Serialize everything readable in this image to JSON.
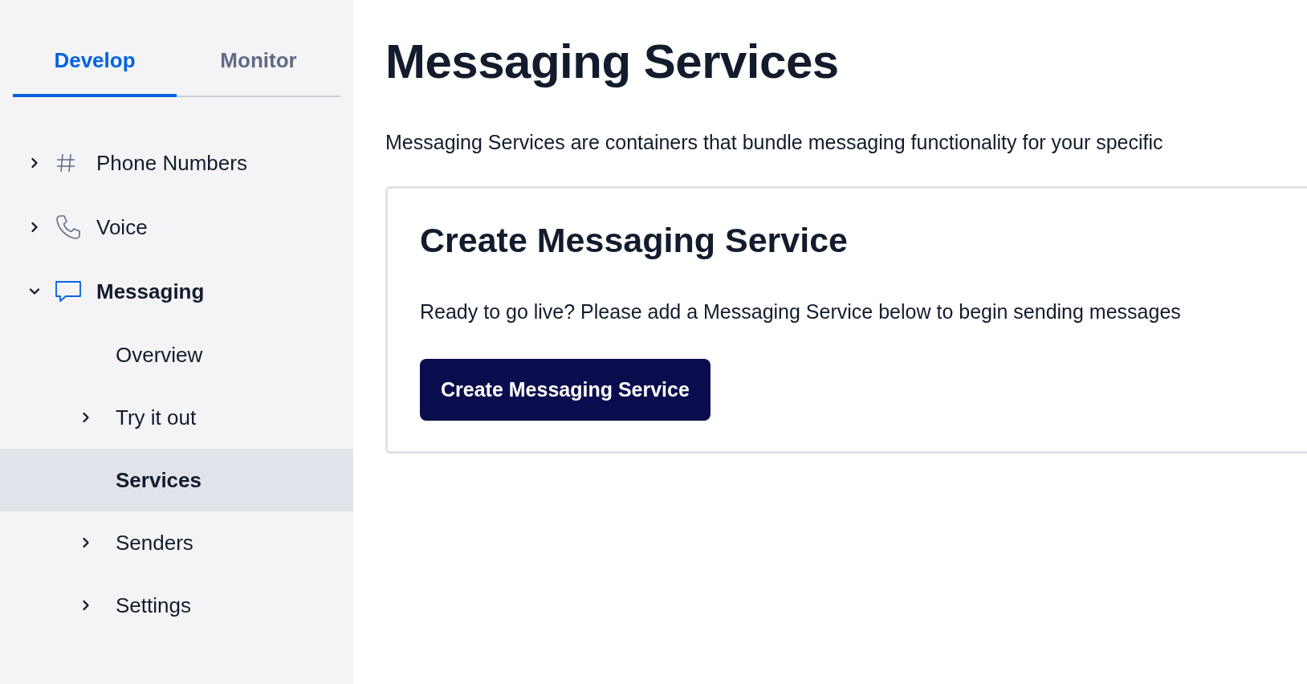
{
  "sidebar": {
    "tabs": [
      {
        "label": "Develop",
        "selected": true
      },
      {
        "label": "Monitor",
        "selected": false
      }
    ],
    "items": [
      {
        "label": "Phone Numbers",
        "expanded": false
      },
      {
        "label": "Voice",
        "expanded": false
      },
      {
        "label": "Messaging",
        "expanded": true,
        "children": [
          {
            "label": "Overview",
            "selected": false
          },
          {
            "label": "Try it out",
            "selected": false,
            "expanded": false
          },
          {
            "label": "Services",
            "selected": true
          },
          {
            "label": "Senders",
            "selected": false,
            "expanded": false
          },
          {
            "label": "Settings",
            "selected": false,
            "expanded": false
          }
        ]
      }
    ]
  },
  "main": {
    "title": "Messaging Services",
    "description": "Messaging Services are containers that bundle messaging functionality for your specific",
    "card": {
      "title": "Create Messaging Service",
      "text": "Ready to go live? Please add a Messaging Service below to begin sending messages",
      "button": "Create Messaging Service"
    }
  }
}
